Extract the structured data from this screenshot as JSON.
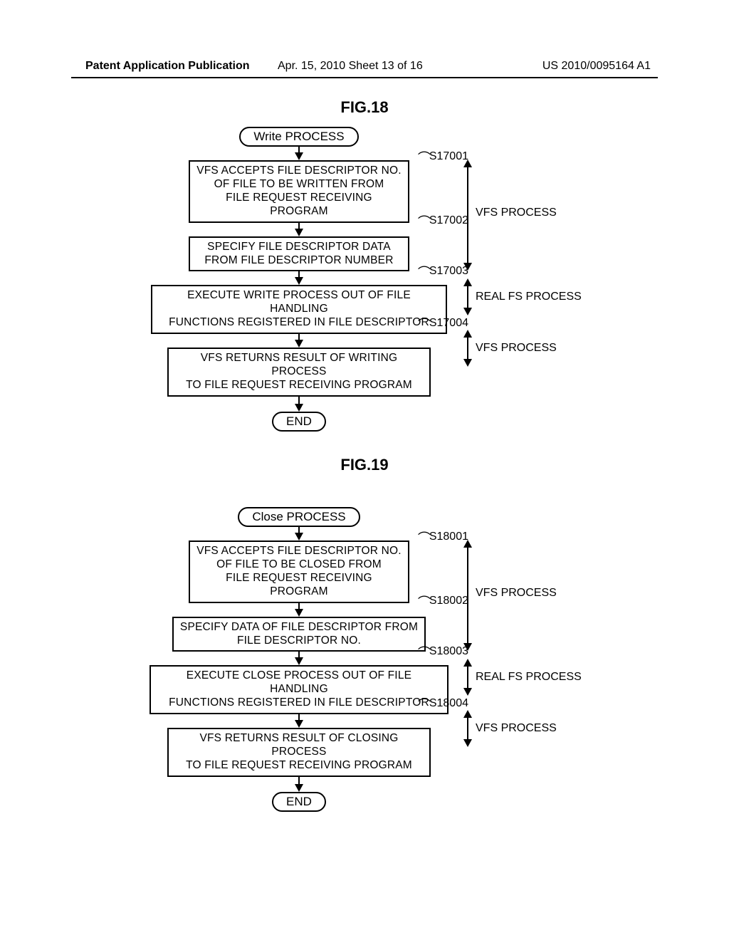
{
  "header": {
    "left": "Patent Application Publication",
    "mid": "Apr. 15, 2010  Sheet 13 of 16",
    "right": "US 2010/0095164 A1"
  },
  "fig18": {
    "title": "FIG.18",
    "start": "Write PROCESS",
    "s1": {
      "tag": "S17001",
      "text": "VFS ACCEPTS FILE DESCRIPTOR NO.\nOF FILE TO BE WRITTEN FROM\nFILE REQUEST RECEIVING PROGRAM"
    },
    "s2": {
      "tag": "S17002",
      "text": "SPECIFY FILE DESCRIPTOR DATA\nFROM FILE DESCRIPTOR NUMBER"
    },
    "s3": {
      "tag": "S17003",
      "text": "EXECUTE WRITE PROCESS OUT OF FILE HANDLING\nFUNCTIONS REGISTERED IN FILE DESCRIPTOR"
    },
    "s4": {
      "tag": "S17004",
      "text": "VFS RETURNS RESULT OF WRITING PROCESS\nTO FILE REQUEST RECEIVING PROGRAM"
    },
    "end": "END",
    "side1": "VFS PROCESS",
    "side2": "REAL FS PROCESS",
    "side3": "VFS PROCESS"
  },
  "fig19": {
    "title": "FIG.19",
    "start": "Close PROCESS",
    "s1": {
      "tag": "S18001",
      "text": "VFS ACCEPTS FILE DESCRIPTOR NO.\nOF FILE TO BE CLOSED FROM\nFILE REQUEST RECEIVING PROGRAM"
    },
    "s2": {
      "tag": "S18002",
      "text": "SPECIFY DATA OF FILE DESCRIPTOR FROM\nFILE DESCRIPTOR NO."
    },
    "s3": {
      "tag": "S18003",
      "text": "EXECUTE CLOSE PROCESS OUT OF FILE HANDLING\nFUNCTIONS REGISTERED IN FILE DESCRIPTOR"
    },
    "s4": {
      "tag": "S18004",
      "text": "VFS RETURNS RESULT OF CLOSING PROCESS\nTO FILE REQUEST RECEIVING PROGRAM"
    },
    "end": "END",
    "side1": "VFS PROCESS",
    "side2": "REAL FS PROCESS",
    "side3": "VFS PROCESS"
  }
}
